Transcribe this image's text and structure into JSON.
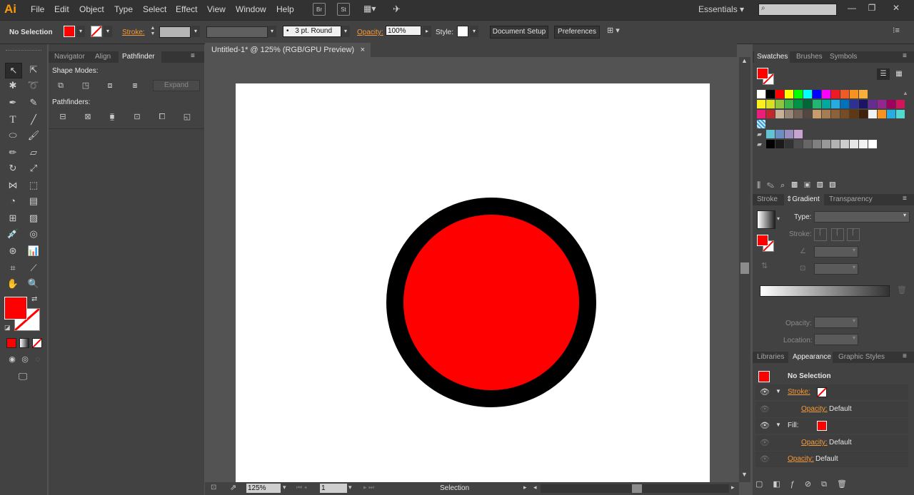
{
  "app": {
    "logo": "Ai"
  },
  "menus": [
    "File",
    "Edit",
    "Object",
    "Type",
    "Select",
    "Effect",
    "View",
    "Window",
    "Help"
  ],
  "menubar_buttons": [
    "Br",
    "St"
  ],
  "workspace": {
    "label": "Essentials"
  },
  "window_buttons": [
    "—",
    "❐",
    "✕"
  ],
  "control_bar": {
    "selection_label": "No Selection",
    "stroke_label": "Stroke:",
    "brush_label": "3 pt. Round",
    "opacity_label": "Opacity:",
    "opacity_value": "100%",
    "style_label": "Style:",
    "document_setup": "Document Setup",
    "preferences": "Preferences"
  },
  "left_panel": {
    "tabs": [
      "Navigator",
      "Align",
      "Pathfinder"
    ],
    "shape_modes_label": "Shape Modes:",
    "expand_label": "Expand",
    "pathfinders_label": "Pathfinders:"
  },
  "document": {
    "tab_title": "Untitled-1* @ 125% (RGB/GPU Preview)",
    "close": "×"
  },
  "status_bar": {
    "zoom": "125%",
    "page": "1",
    "tool": "Selection"
  },
  "swatches_panel": {
    "tabs": [
      "Swatches",
      "Brushes",
      "Symbols"
    ]
  },
  "gradient_panel": {
    "tabs": [
      "Stroke",
      "Gradient",
      "Transparency"
    ],
    "type_label": "Type:",
    "stroke_label": "Stroke:",
    "opacity_label": "Opacity:",
    "location_label": "Location:"
  },
  "appearance_panel": {
    "tabs": [
      "Libraries",
      "Appearance",
      "Graphic Styles"
    ],
    "title": "No Selection",
    "stroke_label": "Stroke:",
    "fill_label": "Fill:",
    "opacity_label": "Opacity:",
    "default_label": "Default"
  },
  "colors": {
    "fill": "#ff0000",
    "stroke": "#000000",
    "accent": "#f59a3a"
  },
  "swatch_rows": [
    [
      "#ffffff",
      "#000000",
      "#ff0000",
      "#ffff00",
      "#00ff00",
      "#00ffff",
      "#0000ff",
      "#ff00ff",
      "#ed1c24",
      "#f15a24",
      "#f7931e",
      "#fbb03b"
    ],
    [
      "#fcee21",
      "#d9e021",
      "#8cc63f",
      "#39b54a",
      "#009245",
      "#006837",
      "#22b573",
      "#00a99d",
      "#29abe2",
      "#0071bc",
      "#2e3192",
      "#1b1464",
      "#662d91",
      "#93278f",
      "#9e005d",
      "#d4145a"
    ],
    [
      "#ed1e79",
      "#c1272d",
      "#c7b299",
      "#998675",
      "#736357",
      "#534741",
      "#c69c6d",
      "#a67c52",
      "#8c6239",
      "#754c24",
      "#603813",
      "#42210b",
      "#f2f2f2",
      "#f7931e",
      "#29abe2",
      "#4fd9cf"
    ],
    [
      "#62c3d5",
      "#6b8fc2",
      "#9a8dbf",
      "#c7a3cf"
    ],
    [
      "#000000",
      "#1a1a1a",
      "#333333",
      "#4d4d4d",
      "#666666",
      "#808080",
      "#999999",
      "#b3b3b3",
      "#cccccc",
      "#e6e6e6",
      "#f2f2f2",
      "#ffffff"
    ]
  ]
}
